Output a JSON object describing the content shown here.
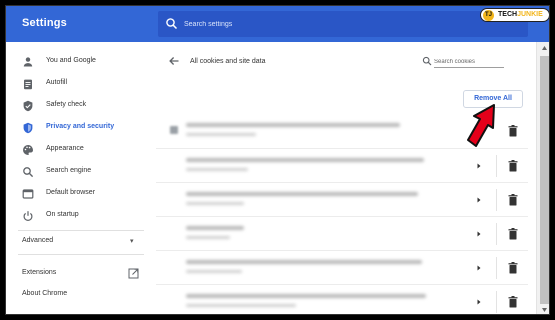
{
  "app": {
    "title": "Settings",
    "search_placeholder": "Search settings",
    "watermark": {
      "prefix": "TECH",
      "suffix": "JUNKIE",
      "mark": "TJ"
    }
  },
  "sidebar": {
    "items": [
      {
        "label": "You and Google",
        "icon": "person-icon"
      },
      {
        "label": "Autofill",
        "icon": "clipboard-icon"
      },
      {
        "label": "Safety check",
        "icon": "shield-check-icon"
      },
      {
        "label": "Privacy and security",
        "icon": "shield-icon",
        "active": true
      },
      {
        "label": "Appearance",
        "icon": "palette-icon"
      },
      {
        "label": "Search engine",
        "icon": "search-icon"
      },
      {
        "label": "Default browser",
        "icon": "browser-icon"
      },
      {
        "label": "On startup",
        "icon": "power-icon"
      }
    ],
    "advanced_label": "Advanced",
    "extensions_label": "Extensions",
    "about_label": "About Chrome"
  },
  "page": {
    "title": "All cookies and site data",
    "search_placeholder": "Search cookies",
    "remove_all_label": "Remove All"
  },
  "colors": {
    "accent": "#3367d6",
    "header_bg": "#3367d6",
    "annotation_arrow": "#e5001a"
  }
}
